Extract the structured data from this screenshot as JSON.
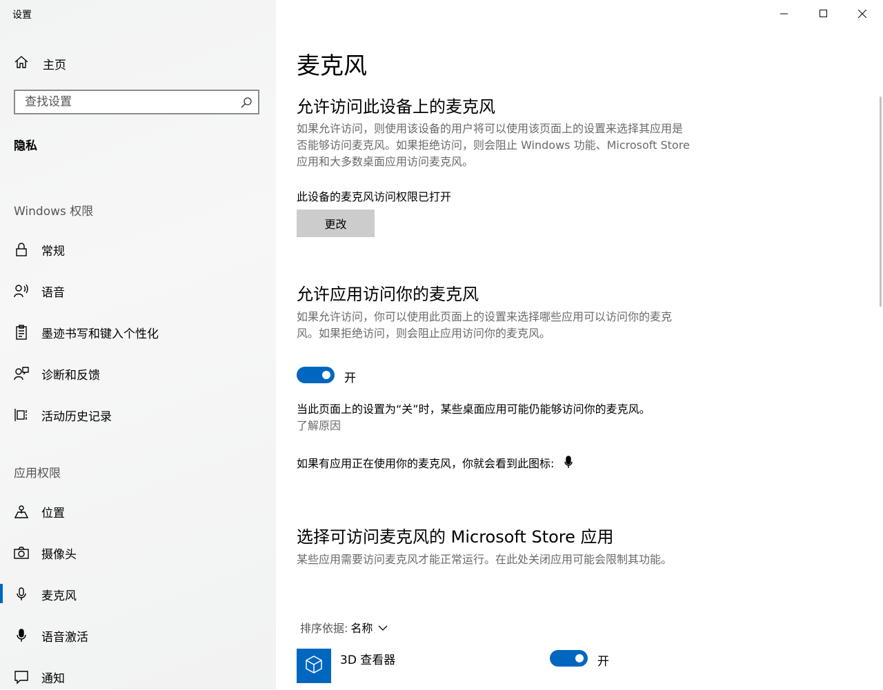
{
  "window": {
    "title": "设置",
    "controls": {
      "minimize": "minimize",
      "maximize": "maximize",
      "close": "close"
    }
  },
  "sidebar": {
    "home_label": "主页",
    "search_placeholder": "查找设置",
    "section_title": "隐私",
    "group_windows": "Windows 权限",
    "windows_items": [
      {
        "label": "常规",
        "icon": "lock-icon"
      },
      {
        "label": "语音",
        "icon": "speech-icon"
      },
      {
        "label": "墨迹书写和键入个性化",
        "icon": "clipboard-icon"
      },
      {
        "label": "诊断和反馈",
        "icon": "feedback-icon"
      },
      {
        "label": "活动历史记录",
        "icon": "timeline-icon"
      }
    ],
    "group_apps": "应用权限",
    "app_items": [
      {
        "label": "位置",
        "icon": "location-icon"
      },
      {
        "label": "摄像头",
        "icon": "camera-icon"
      },
      {
        "label": "麦克风",
        "icon": "microphone-icon",
        "active": true
      },
      {
        "label": "语音激活",
        "icon": "voice-activation-icon"
      },
      {
        "label": "通知",
        "icon": "notification-icon"
      }
    ]
  },
  "main": {
    "title": "麦克风",
    "section1": {
      "heading": "允许访问此设备上的麦克风",
      "desc": "如果允许访问，则使用该设备的用户将可以使用该页面上的设置来选择其应用是否能够访问麦克风。如果拒绝访问，则会阻止 Windows 功能、Microsoft Store 应用和大多数桌面应用访问麦克风。",
      "status": "此设备的麦克风访问权限已打开",
      "button": "更改"
    },
    "section2": {
      "heading": "允许应用访问你的麦克风",
      "desc": "如果允许访问，你可以使用此页面上的设置来选择哪些应用可以访问你的麦克风。如果拒绝访问，则会阻止应用访问你的麦克风。",
      "toggle_label": "开",
      "toggle_on": true,
      "note": "当此页面上的设置为“关”时，某些桌面应用可能仍能够访问你的麦克风。",
      "link": "了解原因",
      "icon_note": "如果有应用正在使用你的麦克风，你就会看到此图标:"
    },
    "section3": {
      "heading": "选择可访问麦克风的 Microsoft Store 应用",
      "desc": "某些应用需要访问麦克风才能正常运行。在此处关闭应用可能会限制其功能。",
      "sort_key": "排序依据:",
      "sort_value": "名称",
      "apps": [
        {
          "name": "3D 查看器",
          "toggle_label": "开",
          "toggle_on": true,
          "icon": "cube-icon"
        }
      ]
    }
  },
  "colors": {
    "accent": "#0067c0",
    "sidebar_bg": "#f2f3f3",
    "button_bg": "#cccccc"
  }
}
